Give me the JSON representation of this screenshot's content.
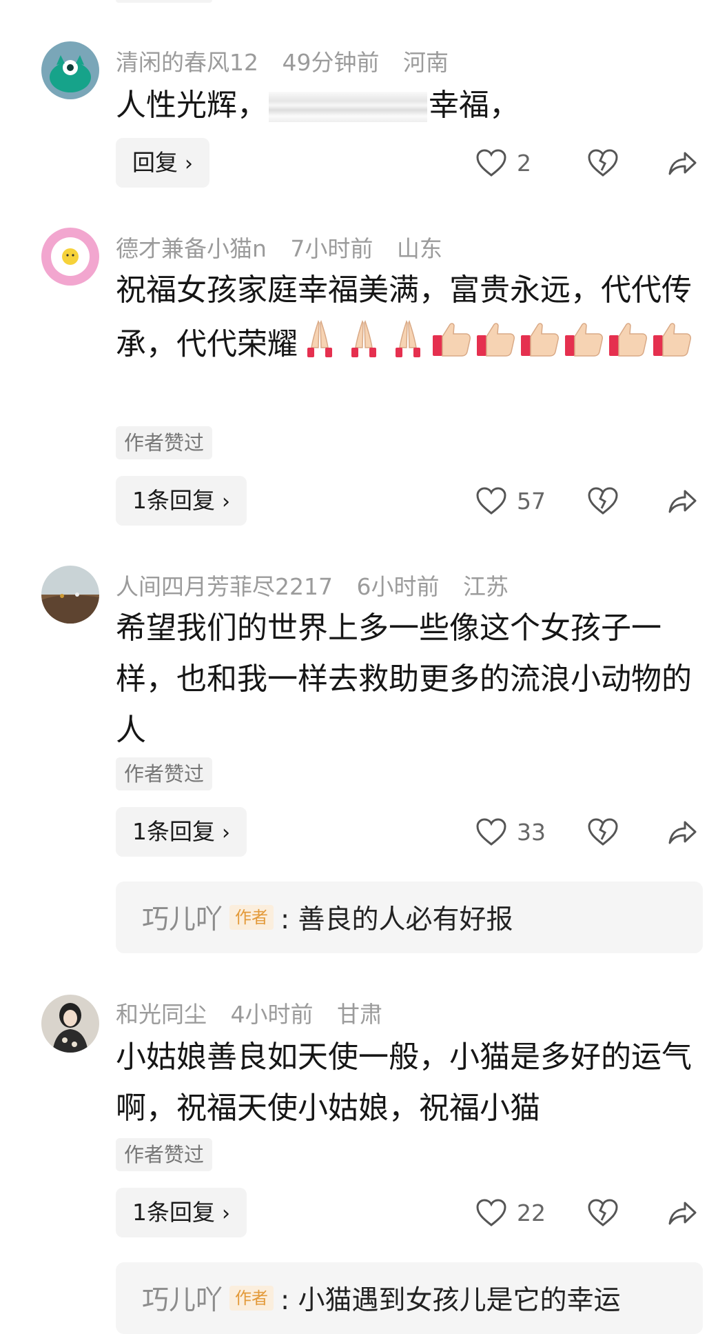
{
  "comments": [
    {
      "username": "清闲的春风12",
      "time": "49分钟前",
      "location": "河南",
      "text_before": "人性光辉，",
      "text_after": "幸福，",
      "reply_label": "回复",
      "likes": "2"
    },
    {
      "username": "德才兼备小猫n",
      "time": "7小时前",
      "location": "山东",
      "text": "祝福女孩家庭幸福美满，富贵永远，代代传承，代代荣耀",
      "emoji": [
        "praying-hands",
        "praying-hands",
        "praying-hands",
        "thumbs-up",
        "thumbs-up",
        "thumbs-up",
        "thumbs-up",
        "thumbs-up",
        "thumbs-up"
      ],
      "badge": "作者赞过",
      "reply_label": "1条回复",
      "likes": "57"
    },
    {
      "username": "人间四月芳菲尽2217",
      "time": "6小时前",
      "location": "江苏",
      "text": "希望我们的世界上多一些像这个女孩子一样，也和我一样去救助更多的流浪小动物的人",
      "badge": "作者赞过",
      "reply_label": "1条回复",
      "likes": "33",
      "subreply": {
        "name": "巧儿吖",
        "tag": "作者",
        "text": ": 善良的人必有好报"
      }
    },
    {
      "username": "和光同尘",
      "time": "4小时前",
      "location": "甘肃",
      "text": "小姑娘善良如天使一般，小猫是多好的运气啊，祝福天使小姑娘，祝福小猫",
      "badge": "作者赞过",
      "reply_label": "1条回复",
      "likes": "22",
      "subreply": {
        "name": "巧儿吖",
        "tag": "作者",
        "text": ": 小猫遇到女孩儿是它的幸运"
      }
    }
  ],
  "colors": {
    "meta": "#9b9b9b",
    "author_tag_bg": "#fbeedd",
    "author_tag_fg": "#e39a3a",
    "pill_bg": "#f3f3f3"
  },
  "icons": {
    "like": "heart-outline-icon",
    "dislike": "broken-heart-icon",
    "share": "share-arrow-icon"
  }
}
